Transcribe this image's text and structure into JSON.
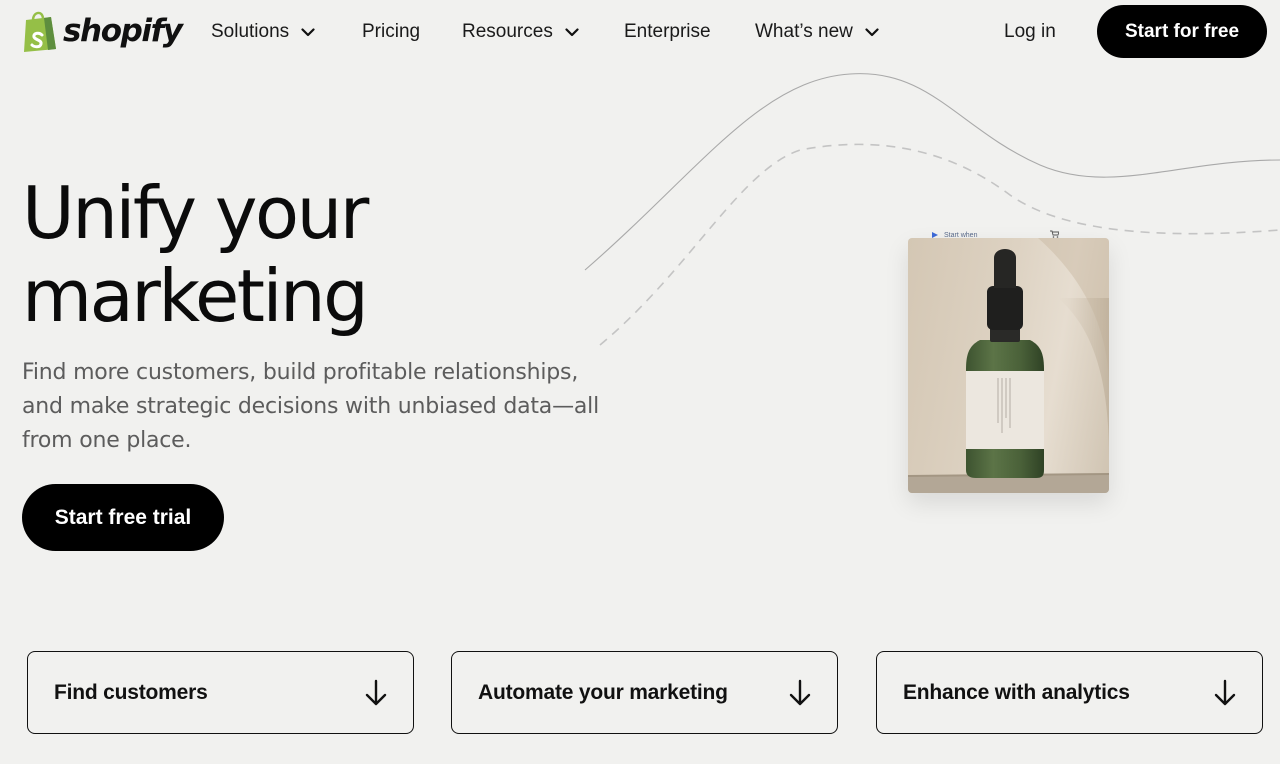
{
  "brand": {
    "name": "shopify",
    "colors": {
      "logo_green": "#95bf47",
      "logo_dark_green": "#5e8e3e",
      "accent": "#000000"
    }
  },
  "nav": {
    "items": [
      {
        "label": "Solutions",
        "has_dropdown": true
      },
      {
        "label": "Pricing",
        "has_dropdown": false
      },
      {
        "label": "Resources",
        "has_dropdown": true
      },
      {
        "label": "Enterprise",
        "has_dropdown": false
      },
      {
        "label": "What’s new",
        "has_dropdown": true
      }
    ],
    "login_label": "Log in",
    "cta_label": "Start for free"
  },
  "hero": {
    "title_line1": "Unify your",
    "title_line2": "marketing",
    "subtitle": "Find more customers, build profitable relationships, and make strategic decisions with unbiased data—all from one place.",
    "cta_label": "Start free trial"
  },
  "illustration": {
    "peek_label": "Start when",
    "icons": [
      "play-icon",
      "cart-icon"
    ]
  },
  "features": [
    {
      "label": "Find customers",
      "icon": "arrow-down-icon"
    },
    {
      "label": "Automate your marketing",
      "icon": "arrow-down-icon"
    },
    {
      "label": "Enhance with analytics",
      "icon": "arrow-down-icon"
    }
  ]
}
